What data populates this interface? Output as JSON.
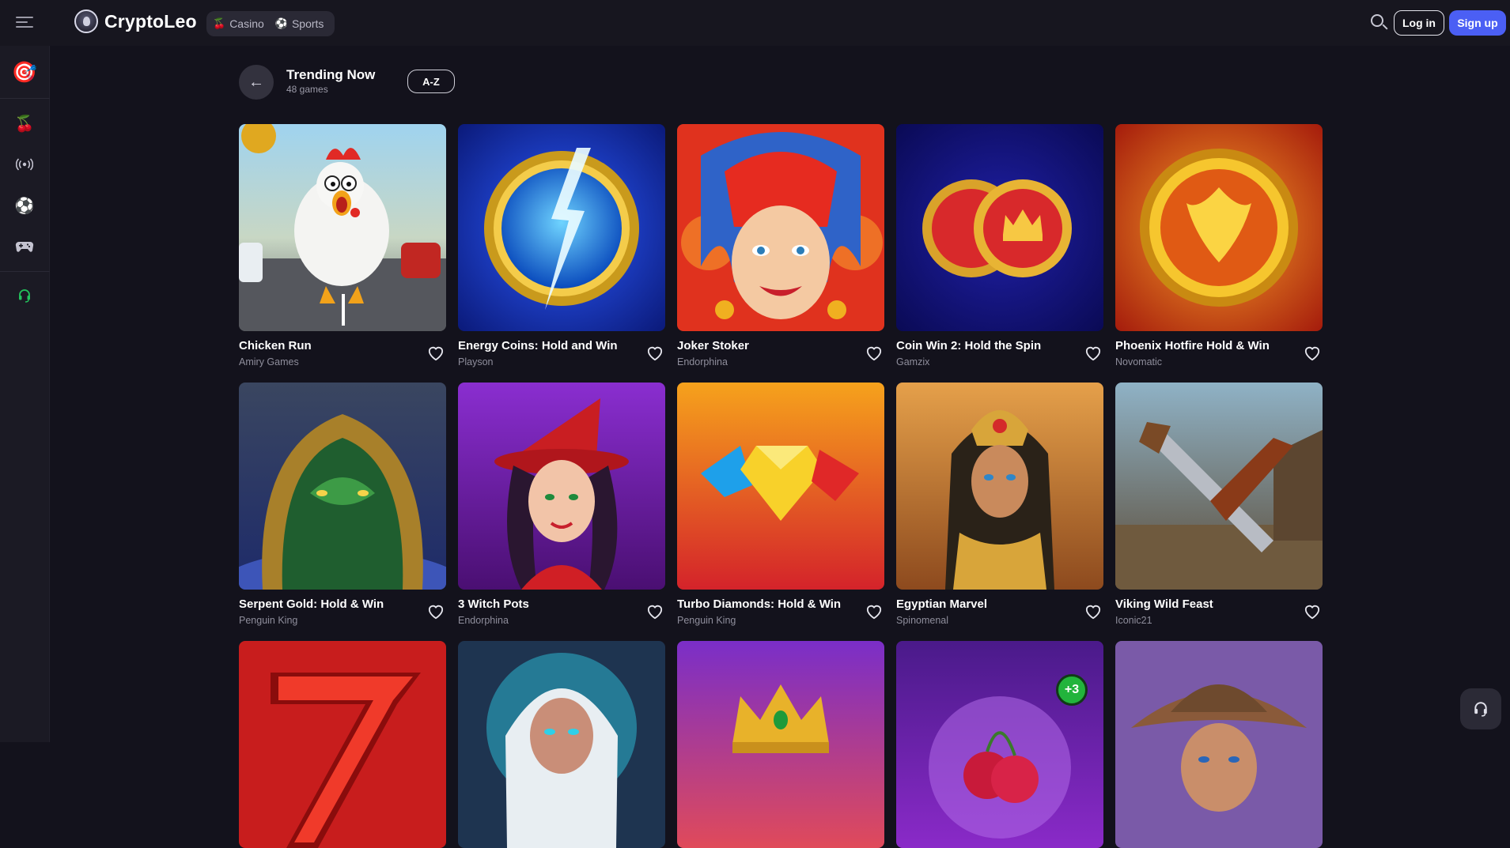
{
  "header": {
    "brand": "CryptoLeo",
    "nav": [
      {
        "label": "Casino",
        "icon": "cherries-icon"
      },
      {
        "label": "Sports",
        "icon": "soccer-ball-icon"
      }
    ],
    "login_label": "Log in",
    "signup_label": "Sign up",
    "signup_color": "#4b5ff4"
  },
  "sidebar": {
    "items": [
      {
        "name": "promo-target",
        "icon": "target-dart-icon"
      },
      {
        "name": "casino",
        "icon": "cherries-icon"
      },
      {
        "name": "live",
        "icon": "broadcast-icon"
      },
      {
        "name": "sports",
        "icon": "soccer-ball-icon"
      },
      {
        "name": "games",
        "icon": "gamepad-icon"
      },
      {
        "name": "support",
        "icon": "headset-icon",
        "color": "#23c35c"
      }
    ]
  },
  "page": {
    "title": "Trending Now",
    "count": "48 games",
    "sort_label": "A-Z"
  },
  "games": [
    {
      "title": "Chicken Run",
      "provider": "Amiry Games"
    },
    {
      "title": "Energy Coins: Hold and Win",
      "provider": "Playson"
    },
    {
      "title": "Joker Stoker",
      "provider": "Endorphina"
    },
    {
      "title": "Coin Win 2: Hold the Spin",
      "provider": "Gamzix"
    },
    {
      "title": "Phoenix Hotfire Hold & Win",
      "provider": "Novomatic"
    },
    {
      "title": "Serpent Gold: Hold & Win",
      "provider": "Penguin King"
    },
    {
      "title": "3 Witch Pots",
      "provider": "Endorphina"
    },
    {
      "title": "Turbo Diamonds: Hold & Win",
      "provider": "Penguin King"
    },
    {
      "title": "Egyptian Marvel",
      "provider": "Spinomenal"
    },
    {
      "title": "Viking Wild Feast",
      "provider": "Iconic21"
    }
  ],
  "partial_row_badge": "+3"
}
